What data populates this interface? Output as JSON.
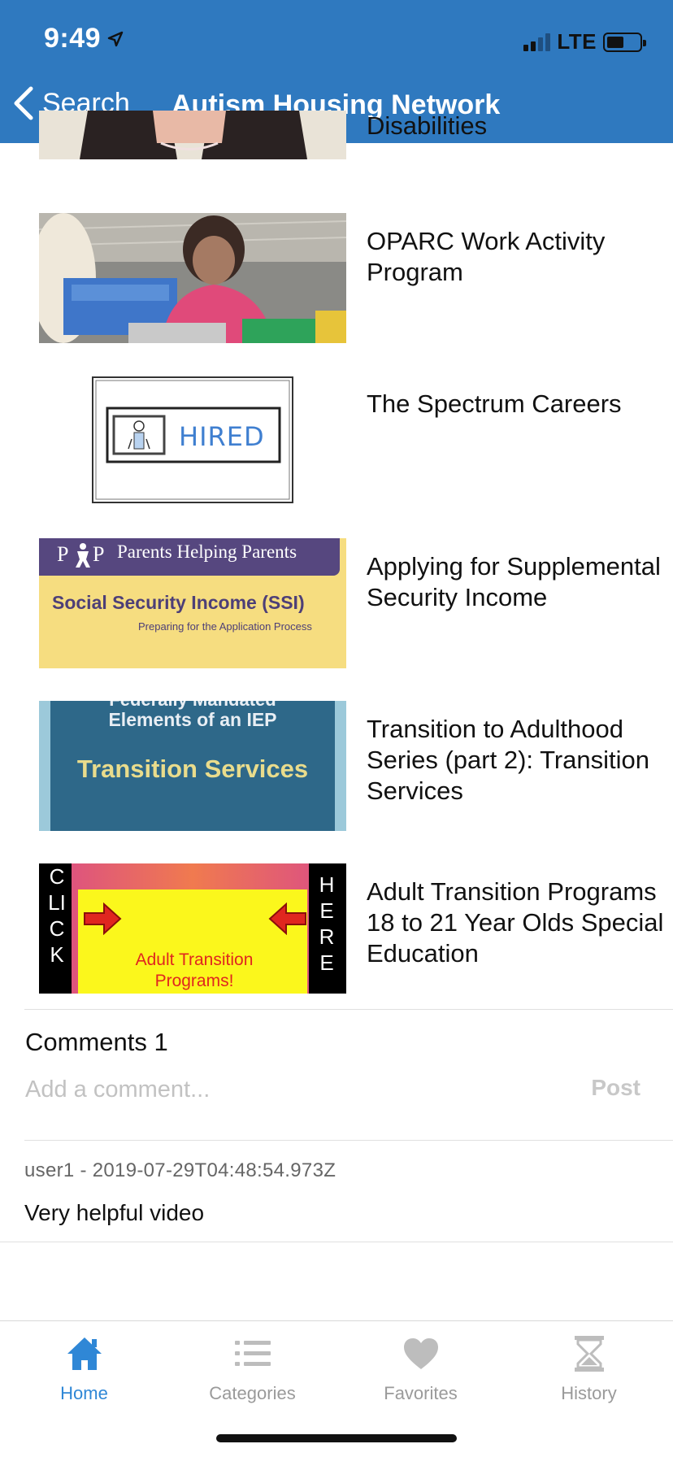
{
  "status_bar": {
    "time": "9:49",
    "network": "LTE"
  },
  "nav": {
    "back_label": "Search",
    "title": "Autism Housing Network"
  },
  "videos": [
    {
      "title": "Disabilities"
    },
    {
      "title": "OPARC Work Activity Program"
    },
    {
      "title": "The Spectrum Careers",
      "thumb_text": "HIRED"
    },
    {
      "title": "Applying for Supplemental Security Income",
      "thumb_header": "Parents Helping Parents",
      "thumb_title": "Social Security Income (SSI)",
      "thumb_sub": "Preparing for the Application Process"
    },
    {
      "title": "Transition to Adulthood Series (part 2): Transition Services",
      "thumb_top": "Federally Mandated",
      "thumb_mid": "Elements of an IEP",
      "thumb_main": "Transition Services"
    },
    {
      "title": "Adult Transition Programs 18 to 21 Year Olds Special Education",
      "thumb_left": "CLICK",
      "thumb_right": "HERE",
      "thumb_main": "Adult Transition Programs!"
    }
  ],
  "comments": {
    "title": "Comments 1",
    "placeholder": "Add a comment...",
    "post_label": "Post",
    "items": [
      {
        "meta": "user1 - 2019-07-29T04:48:54.973Z",
        "text": "Very helpful video"
      }
    ]
  },
  "tabs": [
    {
      "label": "Home",
      "icon": "home-icon",
      "active": true
    },
    {
      "label": "Categories",
      "icon": "list-icon",
      "active": false
    },
    {
      "label": "Favorites",
      "icon": "heart-icon",
      "active": false
    },
    {
      "label": "History",
      "icon": "hourglass-icon",
      "active": false
    }
  ],
  "colors": {
    "header": "#2f79bf",
    "active_tab": "#2f87d6",
    "inactive_tab": "#9a9a9a"
  }
}
